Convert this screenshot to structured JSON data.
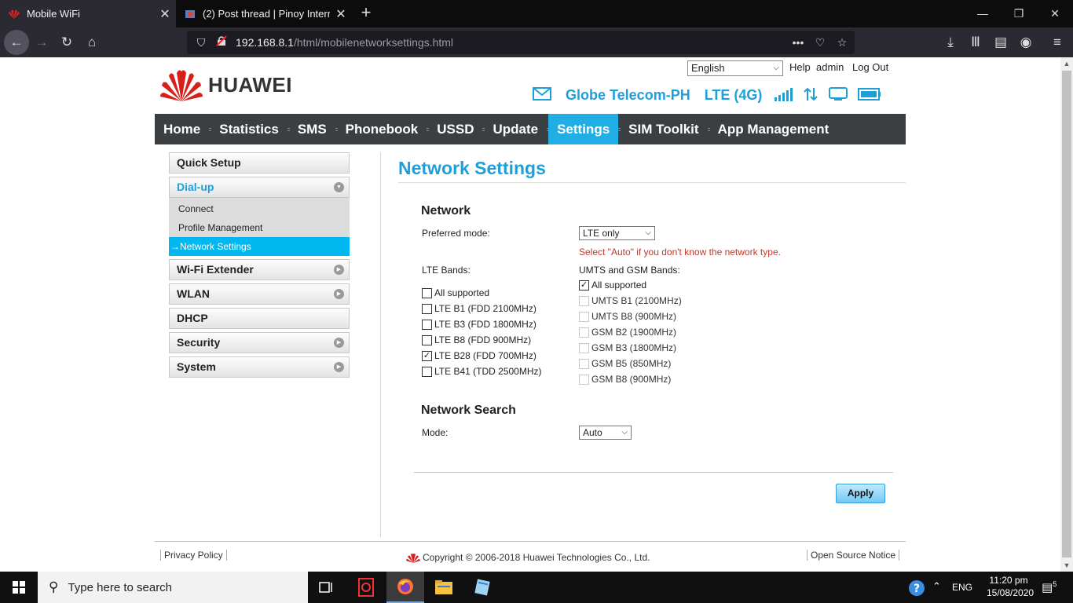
{
  "browser": {
    "tabs": [
      {
        "title": "Mobile WiFi",
        "active": true
      },
      {
        "title": "(2) Post thread | Pinoy Internet",
        "active": false
      }
    ],
    "url_host": "192.168.8.1",
    "url_path": "/html/mobilenetworksettings.html"
  },
  "header": {
    "language": "English",
    "help": "Help",
    "user": "admin",
    "logout": "Log Out",
    "brand": "HUAWEI",
    "carrier": "Globe Telecom-PH",
    "network_type": "LTE (4G)",
    "colors": {
      "accent": "#1e9fd8",
      "nav_bg": "#3c3f42",
      "nav_selected": "#20aee4",
      "brand_red": "#d7201c"
    }
  },
  "mainnav": [
    {
      "label": "Home"
    },
    {
      "label": "Statistics"
    },
    {
      "label": "SMS"
    },
    {
      "label": "Phonebook"
    },
    {
      "label": "USSD"
    },
    {
      "label": "Update"
    },
    {
      "label": "Settings",
      "selected": true
    },
    {
      "label": "SIM Toolkit"
    },
    {
      "label": "App Management"
    }
  ],
  "sidebar": {
    "quick_setup": "Quick Setup",
    "dialup": "Dial-up",
    "dialup_items": [
      "Connect",
      "Profile Management",
      "Network Settings"
    ],
    "wifi_extender": "Wi-Fi Extender",
    "wlan": "WLAN",
    "dhcp": "DHCP",
    "security": "Security",
    "system": "System"
  },
  "content": {
    "title": "Network Settings",
    "network_section": "Network",
    "preferred_mode_label": "Preferred mode:",
    "preferred_mode_value": "LTE only",
    "hint": "Select \"Auto\" if you don't know the network type.",
    "lte_bands_label": "LTE Bands:",
    "umts_gsm_label": "UMTS and GSM Bands:",
    "lte_bands": [
      {
        "label": "All supported",
        "checked": false
      },
      {
        "label": "LTE B1 (FDD 2100MHz)",
        "checked": false
      },
      {
        "label": "LTE B3 (FDD 1800MHz)",
        "checked": false
      },
      {
        "label": "LTE B8 (FDD 900MHz)",
        "checked": false
      },
      {
        "label": "LTE B28 (FDD 700MHz)",
        "checked": true
      },
      {
        "label": "LTE B41 (TDD 2500MHz)",
        "checked": false
      }
    ],
    "umts_bands": [
      {
        "label": "All supported",
        "checked": true
      },
      {
        "label": "UMTS B1 (2100MHz)",
        "checked": false
      },
      {
        "label": "UMTS B8 (900MHz)",
        "checked": false
      },
      {
        "label": "GSM B2 (1900MHz)",
        "checked": false
      },
      {
        "label": "GSM B3 (1800MHz)",
        "checked": false
      },
      {
        "label": "GSM B5 (850MHz)",
        "checked": false
      },
      {
        "label": "GSM B8 (900MHz)",
        "checked": false
      }
    ],
    "search_section": "Network Search",
    "mode_label": "Mode:",
    "mode_value": "Auto",
    "apply": "Apply"
  },
  "footer": {
    "privacy": "Privacy Policy",
    "copyright": "Copyright © 2006-2018 Huawei Technologies Co., Ltd.",
    "open_source": "Open Source Notice"
  },
  "taskbar": {
    "search_placeholder": "Type here to search",
    "language": "ENG",
    "time": "11:20 pm",
    "date": "15/08/2020",
    "notifications": "5"
  }
}
